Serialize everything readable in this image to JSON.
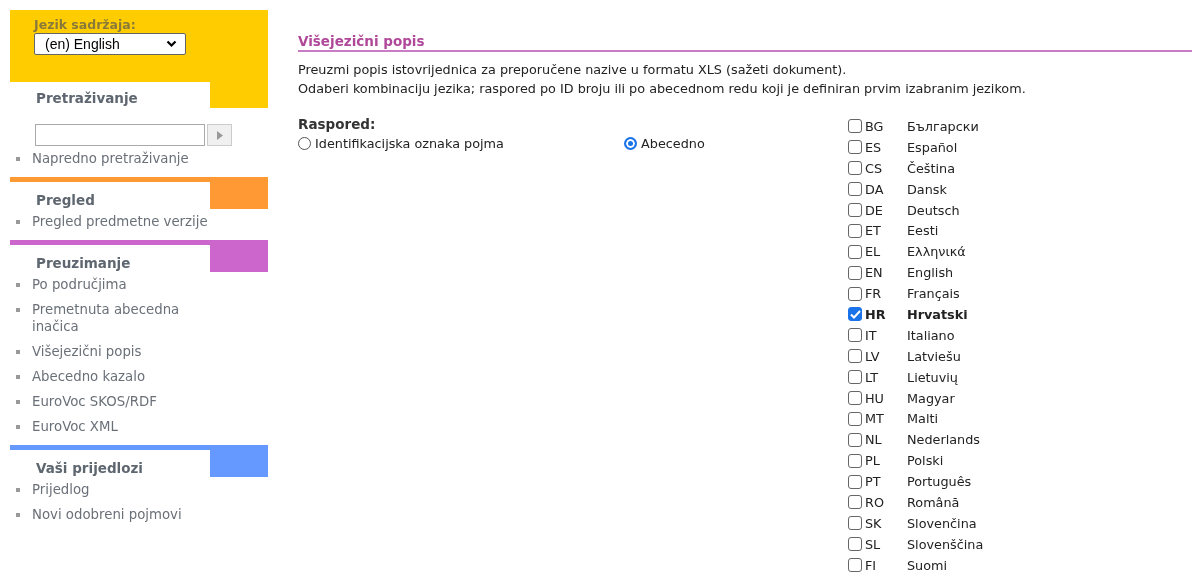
{
  "sidebar": {
    "language_label": "Jezik sadržaja:",
    "language_select": "(en) English",
    "sections": [
      {
        "title": "Pretraživanje",
        "color": "#ffcc00",
        "items": [
          "Napredno pretraživanje"
        ]
      },
      {
        "title": "Pregled",
        "color": "#ff9933",
        "items": [
          "Pregled predmetne verzije"
        ]
      },
      {
        "title": "Preuzimanje",
        "color": "#cc66cc",
        "items": [
          "Po područjima",
          "Premetnuta abecedna inačica",
          "Višejezični popis",
          "Abecedno kazalo",
          "EuroVoc SKOS/RDF",
          "EuroVoc XML"
        ]
      },
      {
        "title": "Vaši prijedlozi",
        "color": "#6699ff",
        "items": [
          "Prijedlog",
          "Novi odobreni pojmovi"
        ]
      }
    ]
  },
  "main": {
    "title": "Višejezični popis",
    "description": [
      "Preuzmi popis istovrijednica za preporučene nazive u formatu XLS (sažeti dokument).",
      "Odaberi kombinaciju jezika; raspored po ID broju ili po abecednom redu koji je definiran prvim izabranim jezikom."
    ],
    "order_label": "Raspored:",
    "order_options": [
      {
        "label": "Identifikacijska oznaka pojma",
        "selected": false
      },
      {
        "label": "Abecedno",
        "selected": true
      }
    ],
    "languages": [
      {
        "code": "BG",
        "name": "Български",
        "checked": false
      },
      {
        "code": "ES",
        "name": "Español",
        "checked": false
      },
      {
        "code": "CS",
        "name": "Čeština",
        "checked": false
      },
      {
        "code": "DA",
        "name": "Dansk",
        "checked": false
      },
      {
        "code": "DE",
        "name": "Deutsch",
        "checked": false
      },
      {
        "code": "ET",
        "name": "Eesti",
        "checked": false
      },
      {
        "code": "EL",
        "name": "Ελληνικά",
        "checked": false
      },
      {
        "code": "EN",
        "name": "English",
        "checked": false
      },
      {
        "code": "FR",
        "name": "Français",
        "checked": false
      },
      {
        "code": "HR",
        "name": "Hrvatski",
        "checked": true
      },
      {
        "code": "IT",
        "name": "Italiano",
        "checked": false
      },
      {
        "code": "LV",
        "name": "Latviešu",
        "checked": false
      },
      {
        "code": "LT",
        "name": "Lietuvių",
        "checked": false
      },
      {
        "code": "HU",
        "name": "Magyar",
        "checked": false
      },
      {
        "code": "MT",
        "name": "Malti",
        "checked": false
      },
      {
        "code": "NL",
        "name": "Nederlands",
        "checked": false
      },
      {
        "code": "PL",
        "name": "Polski",
        "checked": false
      },
      {
        "code": "PT",
        "name": "Português",
        "checked": false
      },
      {
        "code": "RO",
        "name": "Română",
        "checked": false
      },
      {
        "code": "SK",
        "name": "Slovenčina",
        "checked": false
      },
      {
        "code": "SL",
        "name": "Slovenščina",
        "checked": false
      },
      {
        "code": "FI",
        "name": "Suomi",
        "checked": false
      }
    ]
  }
}
